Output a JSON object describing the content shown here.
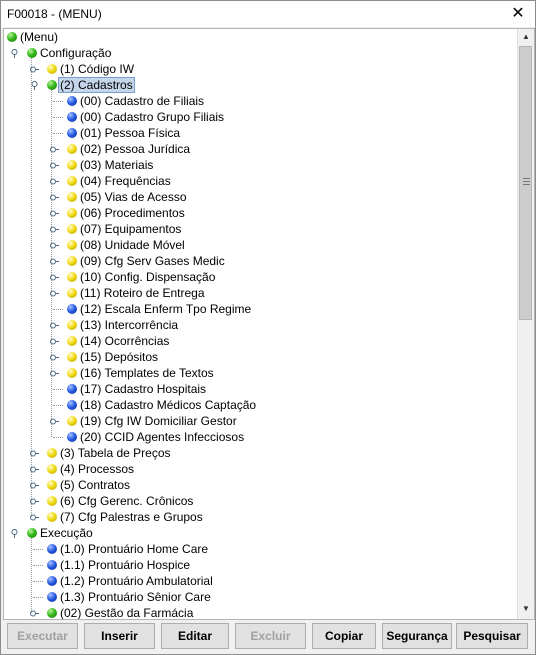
{
  "window": {
    "title": "F00018 - (MENU)",
    "close_glyph": "✕"
  },
  "tree": [
    {
      "label": "(Menu)",
      "icon": "green",
      "depth": 0,
      "handle": "none"
    },
    {
      "label": "Configuração",
      "icon": "green",
      "depth": 1,
      "handle": "expanded"
    },
    {
      "label": "(1) Código IW",
      "icon": "yellow",
      "depth": 2,
      "handle": "collapsed"
    },
    {
      "label": "(2) Cadastros",
      "icon": "green",
      "depth": 2,
      "handle": "expanded",
      "selected": true
    },
    {
      "label": "(00) Cadastro de Filiais",
      "icon": "blue",
      "depth": 3,
      "handle": "leaf"
    },
    {
      "label": "(00) Cadastro Grupo Filiais",
      "icon": "blue",
      "depth": 3,
      "handle": "leaf"
    },
    {
      "label": "(01) Pessoa Física",
      "icon": "blue",
      "depth": 3,
      "handle": "leaf"
    },
    {
      "label": "(02) Pessoa Jurídica",
      "icon": "yellow",
      "depth": 3,
      "handle": "collapsed"
    },
    {
      "label": "(03) Materiais",
      "icon": "yellow",
      "depth": 3,
      "handle": "collapsed"
    },
    {
      "label": "(04) Frequências",
      "icon": "yellow",
      "depth": 3,
      "handle": "collapsed"
    },
    {
      "label": "(05) Vias de Acesso",
      "icon": "yellow",
      "depth": 3,
      "handle": "collapsed"
    },
    {
      "label": "(06) Procedimentos",
      "icon": "yellow",
      "depth": 3,
      "handle": "collapsed"
    },
    {
      "label": "(07) Equipamentos",
      "icon": "yellow",
      "depth": 3,
      "handle": "collapsed"
    },
    {
      "label": "(08) Unidade Móvel",
      "icon": "yellow",
      "depth": 3,
      "handle": "collapsed"
    },
    {
      "label": "(09) Cfg Serv Gases Medic",
      "icon": "yellow",
      "depth": 3,
      "handle": "collapsed"
    },
    {
      "label": "(10) Config. Dispensação",
      "icon": "yellow",
      "depth": 3,
      "handle": "collapsed"
    },
    {
      "label": "(11) Roteiro de Entrega",
      "icon": "yellow",
      "depth": 3,
      "handle": "collapsed"
    },
    {
      "label": "(12) Escala Enferm Tpo Regime",
      "icon": "blue",
      "depth": 3,
      "handle": "leaf"
    },
    {
      "label": "(13) Intercorrência",
      "icon": "yellow",
      "depth": 3,
      "handle": "collapsed"
    },
    {
      "label": "(14) Ocorrências",
      "icon": "yellow",
      "depth": 3,
      "handle": "collapsed"
    },
    {
      "label": "(15) Depósitos",
      "icon": "yellow",
      "depth": 3,
      "handle": "collapsed"
    },
    {
      "label": "(16) Templates de Textos",
      "icon": "yellow",
      "depth": 3,
      "handle": "collapsed"
    },
    {
      "label": "(17) Cadastro Hospitais",
      "icon": "blue",
      "depth": 3,
      "handle": "leaf"
    },
    {
      "label": "(18) Cadastro Médicos Captação",
      "icon": "blue",
      "depth": 3,
      "handle": "leaf"
    },
    {
      "label": "(19) Cfg IW Domiciliar Gestor",
      "icon": "yellow",
      "depth": 3,
      "handle": "collapsed"
    },
    {
      "label": "(20) CCID Agentes Infecciosos",
      "icon": "blue",
      "depth": 3,
      "handle": "leaf"
    },
    {
      "label": "(3) Tabela de Preços",
      "icon": "yellow",
      "depth": 2,
      "handle": "collapsed"
    },
    {
      "label": "(4) Processos",
      "icon": "yellow",
      "depth": 2,
      "handle": "collapsed"
    },
    {
      "label": "(5) Contratos",
      "icon": "yellow",
      "depth": 2,
      "handle": "collapsed"
    },
    {
      "label": "(6) Cfg Gerenc. Crônicos",
      "icon": "yellow",
      "depth": 2,
      "handle": "collapsed"
    },
    {
      "label": "(7) Cfg Palestras e Grupos",
      "icon": "yellow",
      "depth": 2,
      "handle": "collapsed"
    },
    {
      "label": "Execução",
      "icon": "green",
      "depth": 1,
      "handle": "expanded"
    },
    {
      "label": "(1.0) Prontuário Home Care",
      "icon": "blue",
      "depth": 2,
      "handle": "leaf"
    },
    {
      "label": "(1.1) Prontuário Hospice",
      "icon": "blue",
      "depth": 2,
      "handle": "leaf"
    },
    {
      "label": "(1.2) Prontuário Ambulatorial",
      "icon": "blue",
      "depth": 2,
      "handle": "leaf"
    },
    {
      "label": "(1.3) Prontuário Sênior Care",
      "icon": "blue",
      "depth": 2,
      "handle": "leaf"
    },
    {
      "label": "(02) Gestão da Farmácia",
      "icon": "green",
      "depth": 2,
      "handle": "collapsed"
    }
  ],
  "scrollbar": {
    "up_glyph": "▲",
    "down_glyph": "▼"
  },
  "buttons": [
    {
      "label": "Executar",
      "enabled": false
    },
    {
      "label": "Inserir",
      "enabled": true
    },
    {
      "label": "Editar",
      "enabled": true
    },
    {
      "label": "Excluir",
      "enabled": false
    },
    {
      "label": "Copiar",
      "enabled": true
    },
    {
      "label": "Segurança",
      "enabled": true
    },
    {
      "label": "Pesquisar",
      "enabled": true
    }
  ]
}
